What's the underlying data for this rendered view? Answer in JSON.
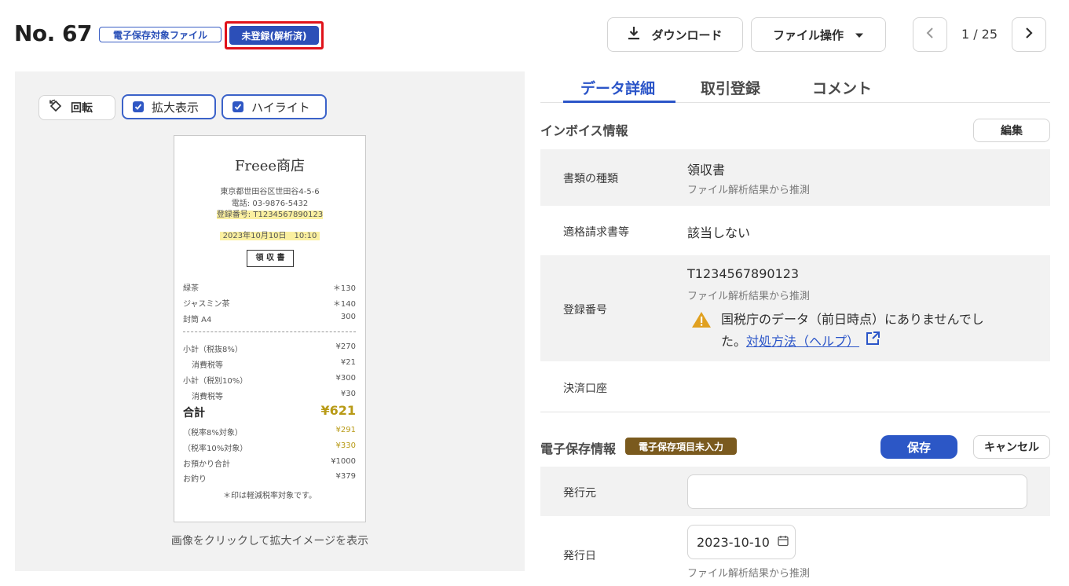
{
  "header": {
    "doc_no": "No. 67",
    "badge_outline": "電子保存対象ファイル",
    "badge_solid": "未登録(解析済)",
    "download_label": "ダウンロード",
    "file_ops_label": "ファイル操作",
    "pager": "1 / 25"
  },
  "preview": {
    "rotate_label": "回転",
    "zoom_label": "拡大表示",
    "highlight_label": "ハイライト",
    "caption": "画像をクリックして拡大イメージを表示",
    "receipt": {
      "shop": "Freee商店",
      "address": "東京都世田谷区世田谷4-5-6",
      "phone": "電話: 03-9876-5432",
      "reg_no": "登録番号: T1234567890123",
      "datetime": "2023年10月10日　10:10",
      "stamp": "領 収 書",
      "items": [
        {
          "name": "緑茶",
          "price": "＊130"
        },
        {
          "name": "ジャスミン茶",
          "price": "＊140"
        },
        {
          "name": "封筒 A4",
          "price": "300"
        }
      ],
      "subtotal8_label": "小計（税抜8%）",
      "subtotal8": "¥270",
      "tax8_label": "消費税等",
      "tax8": "¥21",
      "subtotal10_label": "小計（税別10%）",
      "subtotal10": "¥300",
      "tax10_label": "消費税等",
      "tax10": "¥30",
      "total_label": "合計",
      "total": "¥621",
      "rate8_label": "（税率8%対象）",
      "rate8": "¥291",
      "rate10_label": "（税率10%対象）",
      "rate10": "¥330",
      "paid_label": "お預かり合計",
      "paid": "¥1000",
      "change_label": "お釣り",
      "change": "¥379",
      "note": "＊印は軽減税率対象です。"
    }
  },
  "tabs": [
    "データ詳細",
    "取引登録",
    "コメント"
  ],
  "invoice": {
    "title": "インボイス情報",
    "edit_label": "編集",
    "doc_type_label": "書類の種類",
    "doc_type_value": "領収書",
    "doc_type_sub": "ファイル解析結果から推測",
    "qualified_label": "適格請求書等",
    "qualified_value": "該当しない",
    "reg_label": "登録番号",
    "reg_value": "T1234567890123",
    "reg_sub": "ファイル解析結果から推測",
    "warning_line1": "国税庁のデータ（前日時点）にありませんでし",
    "warning_line2_prefix": "た。",
    "warning_link": "対処方法（ヘルプ）",
    "account_label": "決済口座"
  },
  "estorage": {
    "title": "電子保存情報",
    "badge": "電子保存項目未入力",
    "save_label": "保存",
    "cancel_label": "キャンセル",
    "issuer_label": "発行元",
    "issuer_value": "",
    "issue_date_label": "発行日",
    "issue_date_value": "2023-10-10",
    "issue_date_sub": "ファイル解析結果から推測"
  }
}
